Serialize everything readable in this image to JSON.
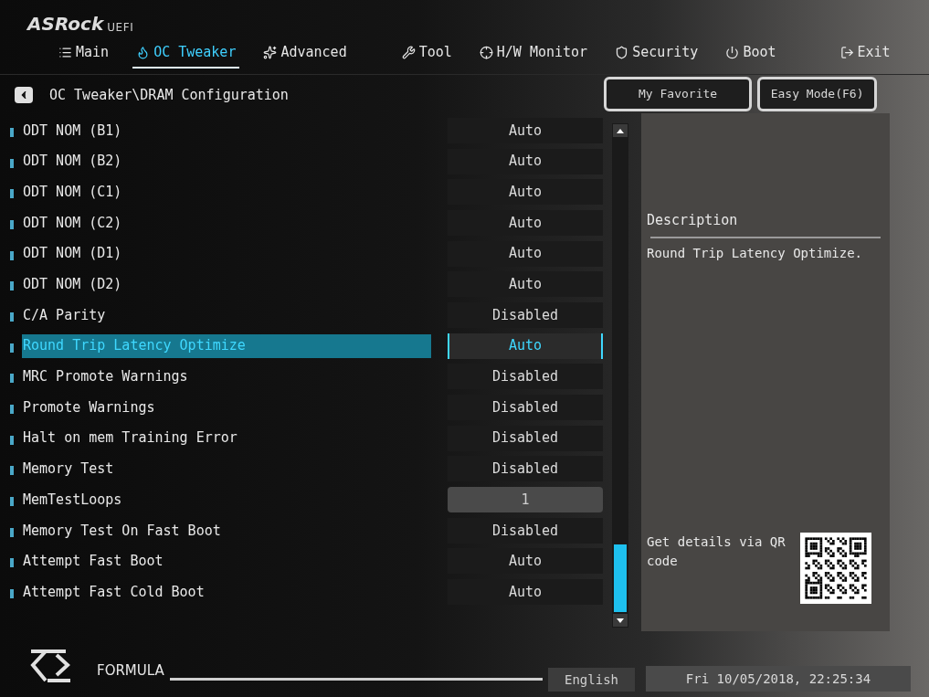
{
  "logo": {
    "brand": "ASRock",
    "suffix": "UEFI"
  },
  "tabs": [
    {
      "label": "Main",
      "selected": false
    },
    {
      "label": "OC Tweaker",
      "selected": true
    },
    {
      "label": "Advanced",
      "selected": false
    },
    {
      "label": "Tool",
      "selected": false
    },
    {
      "label": "H/W Monitor",
      "selected": false
    },
    {
      "label": "Security",
      "selected": false
    },
    {
      "label": "Boot",
      "selected": false
    },
    {
      "label": "Exit",
      "selected": false
    }
  ],
  "breadcrumb": "OC Tweaker\\DRAM Configuration",
  "buttons": [
    "My Favorite",
    "Easy Mode(F6)"
  ],
  "settings": [
    {
      "label": "ODT NOM (B1)",
      "value": "Auto",
      "kind": "option",
      "selected": false
    },
    {
      "label": "ODT NOM (B2)",
      "value": "Auto",
      "kind": "option",
      "selected": false
    },
    {
      "label": "ODT NOM (C1)",
      "value": "Auto",
      "kind": "option",
      "selected": false
    },
    {
      "label": "ODT NOM (C2)",
      "value": "Auto",
      "kind": "option",
      "selected": false
    },
    {
      "label": "ODT NOM (D1)",
      "value": "Auto",
      "kind": "option",
      "selected": false
    },
    {
      "label": "ODT NOM (D2)",
      "value": "Auto",
      "kind": "option",
      "selected": false
    },
    {
      "label": "C/A Parity",
      "value": "Disabled",
      "kind": "option",
      "selected": false
    },
    {
      "label": "Round Trip Latency Optimize",
      "value": "Auto",
      "kind": "option",
      "selected": true
    },
    {
      "label": "MRC Promote Warnings",
      "value": "Disabled",
      "kind": "option",
      "selected": false
    },
    {
      "label": "Promote Warnings",
      "value": "Disabled",
      "kind": "option",
      "selected": false
    },
    {
      "label": "Halt on mem Training Error",
      "value": "Disabled",
      "kind": "option",
      "selected": false
    },
    {
      "label": "Memory Test",
      "value": "Disabled",
      "kind": "option",
      "selected": false
    },
    {
      "label": "MemTestLoops",
      "value": "1",
      "kind": "number",
      "selected": false
    },
    {
      "label": "Memory Test On Fast Boot",
      "value": "Disabled",
      "kind": "option",
      "selected": false
    },
    {
      "label": "Attempt Fast Boot",
      "value": "Auto",
      "kind": "option",
      "selected": false
    },
    {
      "label": "Attempt Fast Cold Boot",
      "value": "Auto",
      "kind": "option",
      "selected": false
    }
  ],
  "description": {
    "title": "Description",
    "text": "Round Trip Latency Optimize."
  },
  "qr": {
    "text": "Get details via QR code"
  },
  "footer": {
    "brand": "FORMULA",
    "language": "English",
    "datetime": "Fri 10/05/2018, 22:25:34"
  }
}
